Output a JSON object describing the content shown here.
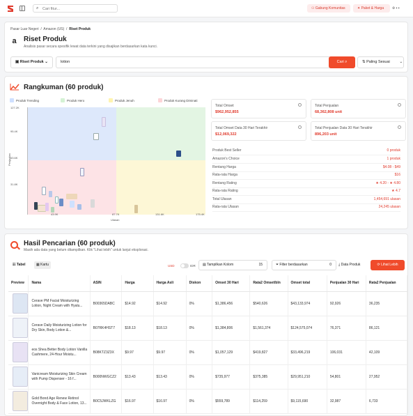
{
  "topbar": {
    "search_placeholder": "Cari fitur...",
    "community_btn": "Gabung Komunitas",
    "plan_btn": "Paket & Harga",
    "colors": {
      "accent": "#f04b2b"
    }
  },
  "header": {
    "breadcrumb": [
      "Pasar Luar Negeri",
      "Amazon (US)",
      "Riset Produk"
    ],
    "title": "Riset Produk",
    "subtitle": "Analisis pasar secara spesifik lewat data terkini yang disajikan berdasarkan kata kunci.",
    "mode_select": "Riset Produk",
    "query": "lotion",
    "search_btn": "Cari",
    "sort_select": "Paling Sesuai"
  },
  "summary": {
    "title": "Rangkuman (60 produk)",
    "legend": [
      "Produk Trending",
      "Produk Hero",
      "Produk Jenuh",
      "Produk Kurang Diminati"
    ],
    "chart_data": {
      "type": "scatter",
      "xlabel": "Ulasan",
      "ylabel": "Penjualan",
      "yticks": [
        "127.2K",
        "95.4K",
        "63.6K",
        "31.8K"
      ],
      "xticks": [
        "43.9K",
        "87.7K",
        "131.6K",
        "175.4K"
      ],
      "quadrants": [
        "Produk Trending",
        "Produk Hero",
        "Produk Kurang Diminati",
        "Produk Jenuh"
      ]
    },
    "stats": [
      {
        "label": "Total Omset",
        "value": "$962,952,855"
      },
      {
        "label": "Total Penjualan",
        "value": "68,362,808 unit"
      },
      {
        "label": "Total Omset Data 30 Hari Terakhir",
        "value": "$12,069,322"
      },
      {
        "label": "Total Penjualan Data 30 Hari Terakhir",
        "value": "896,203 unit"
      }
    ],
    "details": [
      {
        "k": "Produk Best Seller",
        "v": "0 produk"
      },
      {
        "k": "Amazon's Choice",
        "v": "1 produk"
      },
      {
        "k": "Rentang Harga",
        "v": "$4.08 - $49"
      },
      {
        "k": "Rata-rata Harga",
        "v": "$16"
      },
      {
        "k": "Rentang Rating",
        "v": "★ 4.20 - ★ 4.80"
      },
      {
        "k": "Rata-rata Rating",
        "v": "★ 4.7"
      },
      {
        "k": "Total Ulasan",
        "v": "1,454,691 ulasan"
      },
      {
        "k": "Rata-rata Ulasan",
        "v": "24,245 ulasan"
      }
    ]
  },
  "results": {
    "title": "Hasil Pencarian (60 produk)",
    "subtitle": "Masih ada data yang belum ditampilkan. Klik \"Lihat lebih\" untuk lanjut eksplorasi.",
    "view_table": "Tabel",
    "view_card": "Kartu",
    "currency_usd": "USD",
    "currency_idr": "IDR",
    "columns_btn": "Tampilkan Kolom",
    "columns_count": "15",
    "filter_btn": "Filter berdasarkan",
    "filter_count": "0",
    "data_btn": "Data Produk",
    "more_btn": "Lihat Lebih",
    "headers": [
      "Preview",
      "Nama",
      "ASIN",
      "Harga",
      "Harga Asli",
      "Diskon",
      "Omset 30 Hari",
      "Rata2 Omset/bln",
      "Omset total",
      "Penjualan 30 Hari",
      "Rata2 Penjualan"
    ],
    "rows": [
      {
        "name": "Cerave PM Facial Moisturizing Lotion, Night Cream with Hyalu...",
        "asin": "B00365DABC",
        "price": "$14.92",
        "orig": "$14.92",
        "disc": "0%",
        "omset30": "$1,386,456",
        "avg": "$540,626",
        "total": "$43,133,974",
        "sales30": "92,926",
        "avgsales": "36,235"
      },
      {
        "name": "Cerave Daily Moisturizing Lotion for Dry Skin, Body Lotion &...",
        "asin": "B07RK4HST7",
        "price": "$18.13",
        "orig": "$18.13",
        "disc": "0%",
        "omset30": "$1,384,806",
        "avg": "$1,561,374",
        "total": "$124,575,074",
        "sales30": "76,371",
        "avgsales": "86,121"
      },
      {
        "name": "eos Shea Better Body Lotion Vanilla Cashmere, 24-Hour Moistu...",
        "asin": "B08KTZ3Z3X",
        "price": "$9.97",
        "orig": "$9.97",
        "disc": "0%",
        "omset30": "$1,057,129",
        "avg": "$419,827",
        "total": "$33,496,219",
        "sales30": "106,031",
        "avgsales": "42,109"
      },
      {
        "name": "Vanicream Moisturizing Skin Cream with Pump Dispenser - 16 f...",
        "asin": "B000NWGCZ2",
        "price": "$13.43",
        "orig": "$13.43",
        "disc": "0%",
        "omset30": "$735,977",
        "avg": "$375,385",
        "total": "$29,951,210",
        "sales30": "54,801",
        "avgsales": "27,952"
      },
      {
        "name": "Gold Bond Age Renew Retinol Overnight Body & Face Lotion, 13...",
        "asin": "B0C5JWKLZG",
        "price": "$16.97",
        "orig": "$16.97",
        "disc": "0%",
        "omset30": "$559,789",
        "avg": "$114,259",
        "total": "$9,115,690",
        "sales30": "32,987",
        "avgsales": "6,733"
      }
    ]
  }
}
